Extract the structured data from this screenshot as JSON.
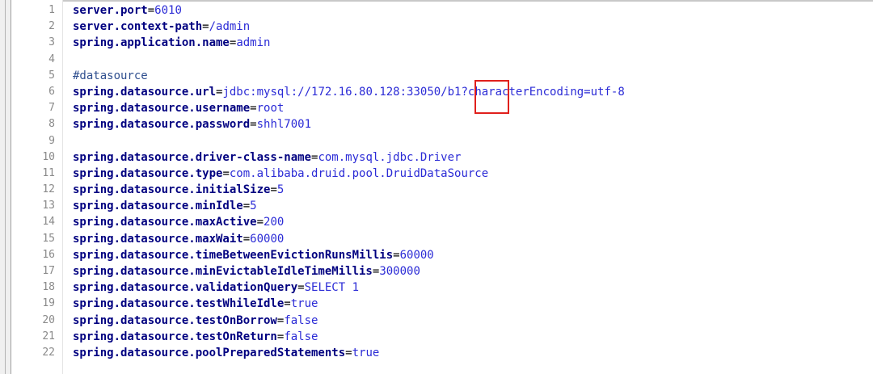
{
  "editor": {
    "lines": [
      {
        "num": "1",
        "key": "server.port",
        "eq": "=",
        "value": "6010",
        "comment": ""
      },
      {
        "num": "2",
        "key": "server.context-path",
        "eq": "=",
        "value": "/admin",
        "comment": ""
      },
      {
        "num": "3",
        "key": "spring.application.name",
        "eq": "=",
        "value": "admin",
        "comment": ""
      },
      {
        "num": "4",
        "key": "",
        "eq": "",
        "value": "",
        "comment": ""
      },
      {
        "num": "5",
        "key": "",
        "eq": "",
        "value": "",
        "comment": "#datasource"
      },
      {
        "num": "6",
        "key": "spring.datasource.url",
        "eq": "=",
        "value": "jdbc:mysql://172.16.80.128:33050/b1?characterEncoding=utf-8",
        "comment": ""
      },
      {
        "num": "7",
        "key": "spring.datasource.username",
        "eq": "=",
        "value": "root",
        "comment": ""
      },
      {
        "num": "8",
        "key": "spring.datasource.password",
        "eq": "=",
        "value": "shhl7001",
        "comment": ""
      },
      {
        "num": "9",
        "key": "",
        "eq": "",
        "value": "",
        "comment": ""
      },
      {
        "num": "10",
        "key": "spring.datasource.driver-class-name",
        "eq": "=",
        "value": "com.mysql.jdbc.Driver",
        "comment": ""
      },
      {
        "num": "11",
        "key": "spring.datasource.type",
        "eq": "=",
        "value": "com.alibaba.druid.pool.DruidDataSource",
        "comment": ""
      },
      {
        "num": "12",
        "key": "spring.datasource.initialSize",
        "eq": "=",
        "value": "5",
        "comment": ""
      },
      {
        "num": "13",
        "key": "spring.datasource.minIdle",
        "eq": "=",
        "value": "5",
        "comment": ""
      },
      {
        "num": "14",
        "key": "spring.datasource.maxActive",
        "eq": "=",
        "value": "200",
        "comment": ""
      },
      {
        "num": "15",
        "key": "spring.datasource.maxWait",
        "eq": "=",
        "value": "60000",
        "comment": ""
      },
      {
        "num": "16",
        "key": "spring.datasource.timeBetweenEvictionRunsMillis",
        "eq": "=",
        "value": "60000",
        "comment": ""
      },
      {
        "num": "17",
        "key": "spring.datasource.minEvictableIdleTimeMillis",
        "eq": "=",
        "value": "300000",
        "comment": ""
      },
      {
        "num": "18",
        "key": "spring.datasource.validationQuery",
        "eq": "=",
        "value": "SELECT 1",
        "comment": ""
      },
      {
        "num": "19",
        "key": "spring.datasource.testWhileIdle",
        "eq": "=",
        "value": "true",
        "comment": ""
      },
      {
        "num": "20",
        "key": "spring.datasource.testOnBorrow",
        "eq": "=",
        "value": "false",
        "comment": ""
      },
      {
        "num": "21",
        "key": "spring.datasource.testOnReturn",
        "eq": "=",
        "value": "false",
        "comment": ""
      },
      {
        "num": "22",
        "key": "spring.datasource.poolPreparedStatements",
        "eq": "=",
        "value": "true",
        "comment": ""
      }
    ]
  },
  "colors": {
    "key": "#000080",
    "value": "#2b2bd6",
    "comment": "#2f4f8f",
    "line_number": "#8a8a8a",
    "highlight": "#e0201c"
  }
}
